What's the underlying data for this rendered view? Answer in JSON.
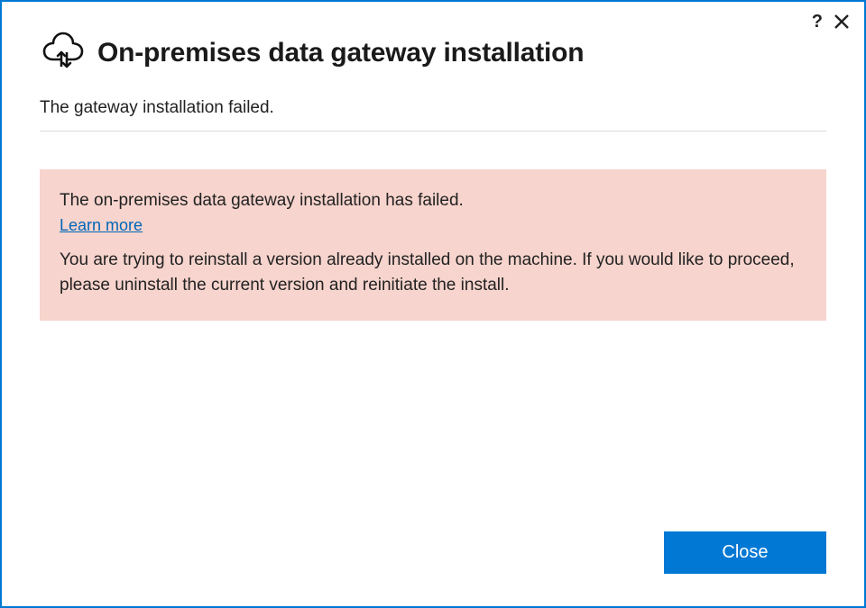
{
  "window": {
    "title": "On-premises data gateway installation"
  },
  "status": {
    "message": "The gateway installation failed."
  },
  "alert": {
    "title": "The on-premises data gateway installation has failed.",
    "learn_more_label": "Learn more",
    "body": "You are trying to reinstall a version already installed on the machine. If you would like to proceed, please uninstall the current version and reinitiate the install."
  },
  "footer": {
    "close_label": "Close"
  },
  "titlebar": {
    "help_glyph": "?"
  }
}
